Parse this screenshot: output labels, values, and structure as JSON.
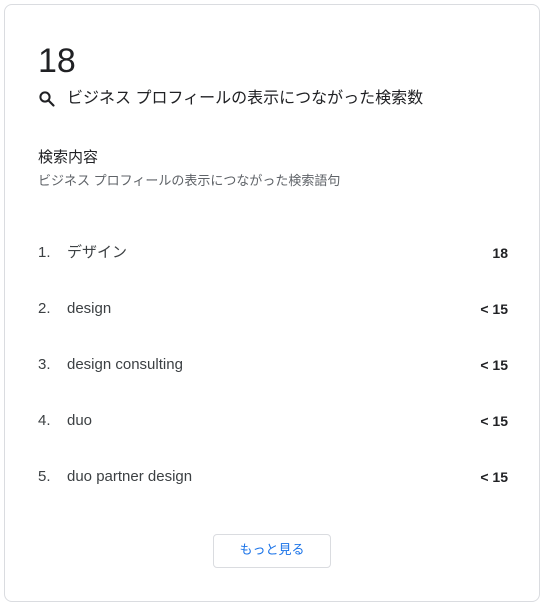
{
  "summary": {
    "total": "18",
    "icon": "search-icon",
    "label": "ビジネス プロフィールの表示につながった検索数"
  },
  "section": {
    "title": "検索内容",
    "subtitle": "ビジネス プロフィールの表示につながった検索語句"
  },
  "terms": [
    {
      "rank": "1.",
      "term": "デザイン",
      "count": "18"
    },
    {
      "rank": "2.",
      "term": "design",
      "count": "< 15"
    },
    {
      "rank": "3.",
      "term": "design consulting",
      "count": "< 15"
    },
    {
      "rank": "4.",
      "term": "duo",
      "count": "< 15"
    },
    {
      "rank": "5.",
      "term": "duo partner design",
      "count": "< 15"
    }
  ],
  "more_button": {
    "label": "もっと見る"
  },
  "colors": {
    "accent": "#1a73e8",
    "text": "#202124",
    "secondary_text": "#5f6368",
    "border": "#dadce0"
  }
}
